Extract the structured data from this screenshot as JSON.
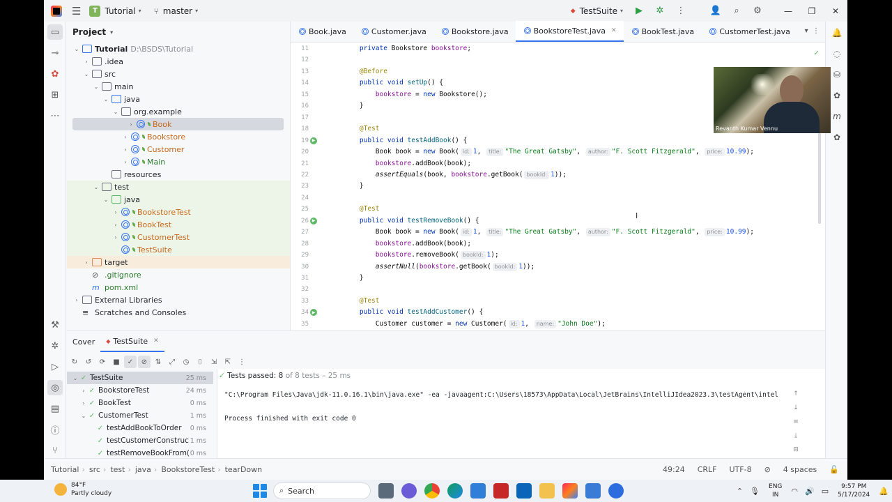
{
  "titlebar": {
    "project_badge": "T",
    "project_name": "Tutorial",
    "branch": "master",
    "run_config": "TestSuite"
  },
  "project_panel": {
    "title": "Project",
    "tree": [
      {
        "label": "Tutorial",
        "extra": "D:\\BSDS\\Tutorial",
        "depth": 0,
        "kind": "module",
        "expanded": true,
        "bold": true
      },
      {
        "label": ".idea",
        "depth": 1,
        "kind": "folder",
        "expanded": false
      },
      {
        "label": "src",
        "depth": 1,
        "kind": "folder",
        "expanded": true
      },
      {
        "label": "main",
        "depth": 2,
        "kind": "folder",
        "expanded": true
      },
      {
        "label": "java",
        "depth": 3,
        "kind": "folder-blue",
        "expanded": true
      },
      {
        "label": "org.example",
        "depth": 4,
        "kind": "package",
        "expanded": true
      },
      {
        "label": "Book",
        "depth": 5,
        "kind": "class",
        "expanded": false,
        "color": "orange",
        "selected": true
      },
      {
        "label": "Bookstore",
        "depth": 5,
        "kind": "class",
        "expanded": false,
        "color": "orange"
      },
      {
        "label": "Customer",
        "depth": 5,
        "kind": "class",
        "expanded": false,
        "color": "orange"
      },
      {
        "label": "Main",
        "depth": 5,
        "kind": "class",
        "expanded": false,
        "color": "green"
      },
      {
        "label": "resources",
        "depth": 3,
        "kind": "folder",
        "noarrow": true
      },
      {
        "label": "test",
        "depth": 2,
        "kind": "folder",
        "expanded": true,
        "green": true
      },
      {
        "label": "java",
        "depth": 3,
        "kind": "folder-green",
        "expanded": true,
        "green": true
      },
      {
        "label": "BookstoreTest",
        "depth": 4,
        "kind": "class",
        "expanded": false,
        "color": "orange",
        "green": true
      },
      {
        "label": "BookTest",
        "depth": 4,
        "kind": "class",
        "expanded": false,
        "color": "orange",
        "green": true
      },
      {
        "label": "CustomerTest",
        "depth": 4,
        "kind": "class",
        "expanded": false,
        "color": "orange",
        "green": true
      },
      {
        "label": "TestSuite",
        "depth": 4,
        "kind": "class",
        "noarrow": true,
        "color": "orange",
        "green": true
      },
      {
        "label": "target",
        "depth": 1,
        "kind": "folder-orange",
        "expanded": false,
        "tgt": true
      },
      {
        "label": ".gitignore",
        "depth": 1,
        "kind": "file",
        "noarrow": true,
        "color": "green"
      },
      {
        "label": "pom.xml",
        "depth": 1,
        "kind": "file-m",
        "noarrow": true,
        "color": "green"
      },
      {
        "label": "External Libraries",
        "depth": 0,
        "kind": "lib",
        "expanded": false
      },
      {
        "label": "Scratches and Consoles",
        "depth": 0,
        "kind": "scratch",
        "noarrow": true
      }
    ]
  },
  "editor": {
    "tabs": [
      {
        "label": "Book.java",
        "active": false
      },
      {
        "label": "Customer.java",
        "active": false
      },
      {
        "label": "Bookstore.java",
        "active": false
      },
      {
        "label": "BookstoreTest.java",
        "active": true
      },
      {
        "label": "BookTest.java",
        "active": false
      },
      {
        "label": "CustomerTest.java",
        "active": false
      }
    ],
    "lines": [
      {
        "n": "11",
        "runmark": false,
        "segs": [
          [
            "    ",
            ""
          ],
          [
            "private ",
            "kw"
          ],
          [
            "Bookstore ",
            ""
          ],
          [
            "bookstore",
            "fld"
          ],
          [
            ";",
            ""
          ]
        ]
      },
      {
        "n": "12",
        "runmark": false,
        "segs": []
      },
      {
        "n": "13",
        "runmark": false,
        "segs": [
          [
            "    ",
            ""
          ],
          [
            "@Before",
            "ann"
          ]
        ]
      },
      {
        "n": "14",
        "runmark": false,
        "segs": [
          [
            "    ",
            ""
          ],
          [
            "public void ",
            "kw"
          ],
          [
            "setUp",
            "fn"
          ],
          [
            "() {",
            ""
          ]
        ]
      },
      {
        "n": "15",
        "runmark": false,
        "segs": [
          [
            "        ",
            ""
          ],
          [
            "bookstore",
            "fld"
          ],
          [
            " = ",
            ""
          ],
          [
            "new ",
            "kw"
          ],
          [
            "Bookstore();",
            ""
          ]
        ]
      },
      {
        "n": "16",
        "runmark": false,
        "segs": [
          [
            "    }",
            ""
          ]
        ]
      },
      {
        "n": "17",
        "runmark": false,
        "segs": []
      },
      {
        "n": "18",
        "runmark": false,
        "segs": [
          [
            "    ",
            ""
          ],
          [
            "@Test",
            "ann"
          ]
        ]
      },
      {
        "n": "19",
        "runmark": true,
        "segs": [
          [
            "    ",
            ""
          ],
          [
            "public void ",
            "kw"
          ],
          [
            "testAddBook",
            "fn"
          ],
          [
            "() {",
            ""
          ]
        ]
      },
      {
        "n": "20",
        "runmark": false,
        "segs": [
          [
            "        Book book = ",
            ""
          ],
          [
            "new ",
            "kw"
          ],
          [
            "Book(",
            ""
          ],
          [
            "id:",
            "hint"
          ],
          [
            "1",
            "num"
          ],
          [
            ", ",
            ""
          ],
          [
            "title:",
            "hint"
          ],
          [
            "\"The Great Gatsby\"",
            "str"
          ],
          [
            ", ",
            ""
          ],
          [
            "author:",
            "hint"
          ],
          [
            "\"F. Scott Fitzgerald\"",
            "str"
          ],
          [
            ", ",
            ""
          ],
          [
            "price:",
            "hint"
          ],
          [
            "10.99",
            "num"
          ],
          [
            ");",
            ""
          ]
        ]
      },
      {
        "n": "21",
        "runmark": false,
        "segs": [
          [
            "        ",
            ""
          ],
          [
            "bookstore",
            "fld"
          ],
          [
            ".addBook(book);",
            ""
          ]
        ]
      },
      {
        "n": "22",
        "runmark": false,
        "segs": [
          [
            "        ",
            ""
          ],
          [
            "assertEquals",
            "it"
          ],
          [
            "(book, ",
            ""
          ],
          [
            "bookstore",
            "fld"
          ],
          [
            ".getBook(",
            ""
          ],
          [
            "bookId:",
            "hint"
          ],
          [
            "1",
            "num"
          ],
          [
            "));",
            ""
          ]
        ]
      },
      {
        "n": "23",
        "runmark": false,
        "segs": [
          [
            "    }",
            ""
          ]
        ]
      },
      {
        "n": "24",
        "runmark": false,
        "segs": []
      },
      {
        "n": "25",
        "runmark": false,
        "segs": [
          [
            "    ",
            ""
          ],
          [
            "@Test",
            "ann"
          ]
        ]
      },
      {
        "n": "26",
        "runmark": true,
        "segs": [
          [
            "    ",
            ""
          ],
          [
            "public void ",
            "kw"
          ],
          [
            "testRemoveBook",
            "fn"
          ],
          [
            "() {",
            ""
          ]
        ]
      },
      {
        "n": "27",
        "runmark": false,
        "segs": [
          [
            "        Book book = ",
            ""
          ],
          [
            "new ",
            "kw"
          ],
          [
            "Book(",
            ""
          ],
          [
            "id:",
            "hint"
          ],
          [
            "1",
            "num"
          ],
          [
            ", ",
            ""
          ],
          [
            "title:",
            "hint"
          ],
          [
            "\"The Great Gatsby\"",
            "str"
          ],
          [
            ", ",
            ""
          ],
          [
            "author:",
            "hint"
          ],
          [
            "\"F. Scott Fitzgerald\"",
            "str"
          ],
          [
            ", ",
            ""
          ],
          [
            "price:",
            "hint"
          ],
          [
            "10.99",
            "num"
          ],
          [
            ");",
            ""
          ]
        ]
      },
      {
        "n": "28",
        "runmark": false,
        "segs": [
          [
            "        ",
            ""
          ],
          [
            "bookstore",
            "fld"
          ],
          [
            ".addBook(book);",
            ""
          ]
        ]
      },
      {
        "n": "29",
        "runmark": false,
        "segs": [
          [
            "        ",
            ""
          ],
          [
            "bookstore",
            "fld"
          ],
          [
            ".removeBook(",
            ""
          ],
          [
            "bookId:",
            "hint"
          ],
          [
            "1",
            "num"
          ],
          [
            ");",
            ""
          ]
        ]
      },
      {
        "n": "30",
        "runmark": false,
        "segs": [
          [
            "        ",
            ""
          ],
          [
            "assertNull",
            "it"
          ],
          [
            "(",
            ""
          ],
          [
            "bookstore",
            "fld"
          ],
          [
            ".getBook(",
            ""
          ],
          [
            "bookId:",
            "hint"
          ],
          [
            "1",
            "num"
          ],
          [
            "));",
            ""
          ]
        ]
      },
      {
        "n": "31",
        "runmark": false,
        "segs": [
          [
            "    }",
            ""
          ]
        ]
      },
      {
        "n": "32",
        "runmark": false,
        "segs": []
      },
      {
        "n": "33",
        "runmark": false,
        "segs": [
          [
            "    ",
            ""
          ],
          [
            "@Test",
            "ann"
          ]
        ]
      },
      {
        "n": "34",
        "runmark": true,
        "segs": [
          [
            "    ",
            ""
          ],
          [
            "public void ",
            "kw"
          ],
          [
            "testAddCustomer",
            "fn"
          ],
          [
            "() {",
            ""
          ]
        ]
      },
      {
        "n": "35",
        "runmark": false,
        "segs": [
          [
            "        Customer customer = ",
            ""
          ],
          [
            "new ",
            "kw"
          ],
          [
            "Customer(",
            ""
          ],
          [
            "id:",
            "hint"
          ],
          [
            "1",
            "num"
          ],
          [
            ", ",
            ""
          ],
          [
            "name:",
            "hint"
          ],
          [
            "\"John Doe\"",
            "str"
          ],
          [
            ");",
            ""
          ]
        ]
      }
    ],
    "webcam_name": "Revanth Kumar Vennu"
  },
  "bottom_panel": {
    "tabs": [
      {
        "label": "Cover",
        "active": false
      },
      {
        "label": "TestSuite",
        "active": true
      }
    ],
    "tests": [
      {
        "label": "TestSuite",
        "time": "25 ms",
        "depth": 0,
        "expanded": true,
        "selected": true
      },
      {
        "label": "BookstoreTest",
        "time": "24 ms",
        "depth": 1,
        "expanded": false
      },
      {
        "label": "BookTest",
        "time": "0 ms",
        "depth": 1,
        "expanded": false
      },
      {
        "label": "CustomerTest",
        "time": "1 ms",
        "depth": 1,
        "expanded": true
      },
      {
        "label": "testAddBookToOrder",
        "time": "0 ms",
        "depth": 2
      },
      {
        "label": "testCustomerConstruc",
        "time": "1 ms",
        "depth": 2
      },
      {
        "label": "testRemoveBookFrom(",
        "time": "0 ms",
        "depth": 2
      }
    ],
    "summary_bold": "Tests passed: 8",
    "summary_rest": "of 8 tests – 25 ms",
    "console_cmd": "\"C:\\Program Files\\Java\\jdk-11.0.16.1\\bin\\java.exe\" -ea -javaagent:C:\\Users\\18573\\AppData\\Local\\JetBrains\\IntelliJIdea2023.3\\testAgent\\intel",
    "console_exit": "Process finished with exit code 0"
  },
  "statusbar": {
    "crumbs": [
      "Tutorial",
      "src",
      "test",
      "java",
      "BookstoreTest",
      "tearDown"
    ],
    "position": "49:24",
    "line_sep": "CRLF",
    "encoding": "UTF-8",
    "indent": "4 spaces"
  },
  "taskbar": {
    "temp": "84°F",
    "weather": "Partly cloudy",
    "search": "Search",
    "lang1": "ENG",
    "lang2": "IN",
    "time": "9:57 PM",
    "date": "5/17/2024"
  }
}
